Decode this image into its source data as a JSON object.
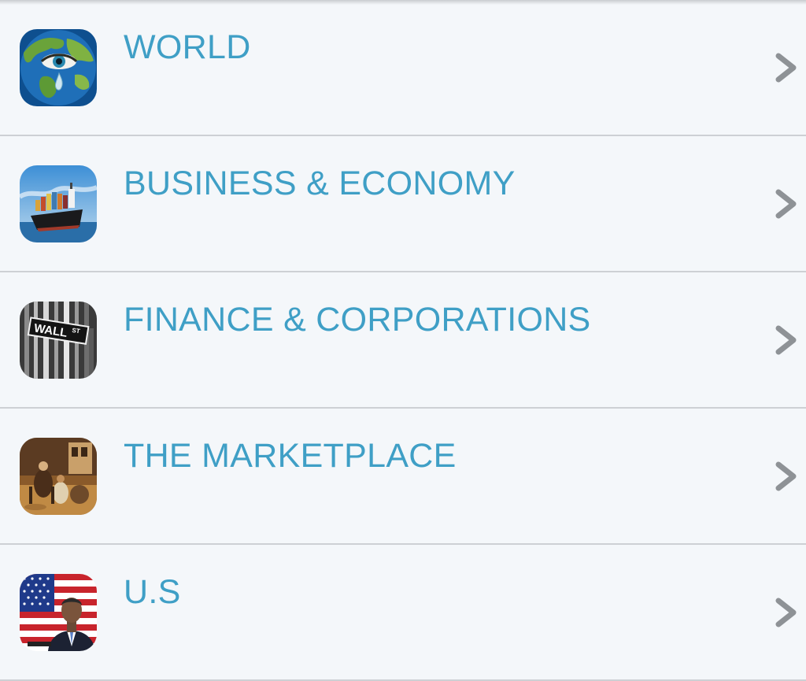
{
  "categories": [
    {
      "label": "WORLD",
      "icon": "world-eye-globe-icon"
    },
    {
      "label": "BUSINESS & ECONOMY",
      "icon": "cargo-ship-icon"
    },
    {
      "label": "FINANCE & CORPORATIONS",
      "icon": "wall-street-sign-icon"
    },
    {
      "label": "THE MARKETPLACE",
      "icon": "bazaar-scene-icon"
    },
    {
      "label": "U.S",
      "icon": "us-flag-portrait-icon"
    }
  ],
  "colors": {
    "background": "#f4f7fa",
    "label": "#3f9fc6",
    "chevron": "#8e9296",
    "divider": "#cdd0d4"
  }
}
